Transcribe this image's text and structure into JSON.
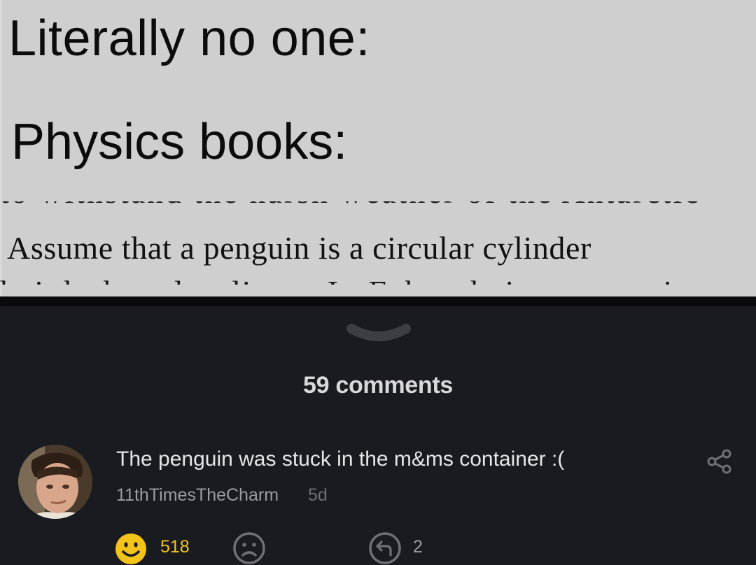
{
  "meme": {
    "line1": "Literally no one:",
    "line2": "Physics books:",
    "line3": "Assume that a penguin is a circular cylinder",
    "cut_top": "to withstand the harsh weather of the Antarctic",
    "cut_bottom": "height h and radius r. In Fahrenheit, a penguin would"
  },
  "comments_header": {
    "count_label": "59 comments"
  },
  "comment": {
    "text": "The penguin was stuck in the m&ms container :(",
    "author": "11thTimesTheCharm",
    "age": "5d",
    "upvotes": "518",
    "replies": "2"
  },
  "colors": {
    "background": "#1a1b20",
    "upvote_accent": "#f2c318",
    "meme_background": "#cfcfcf"
  },
  "icons": [
    "collapse-chevron-icon",
    "share-icon",
    "smiley-upvote-icon",
    "frown-downvote-icon",
    "reply-icon"
  ]
}
